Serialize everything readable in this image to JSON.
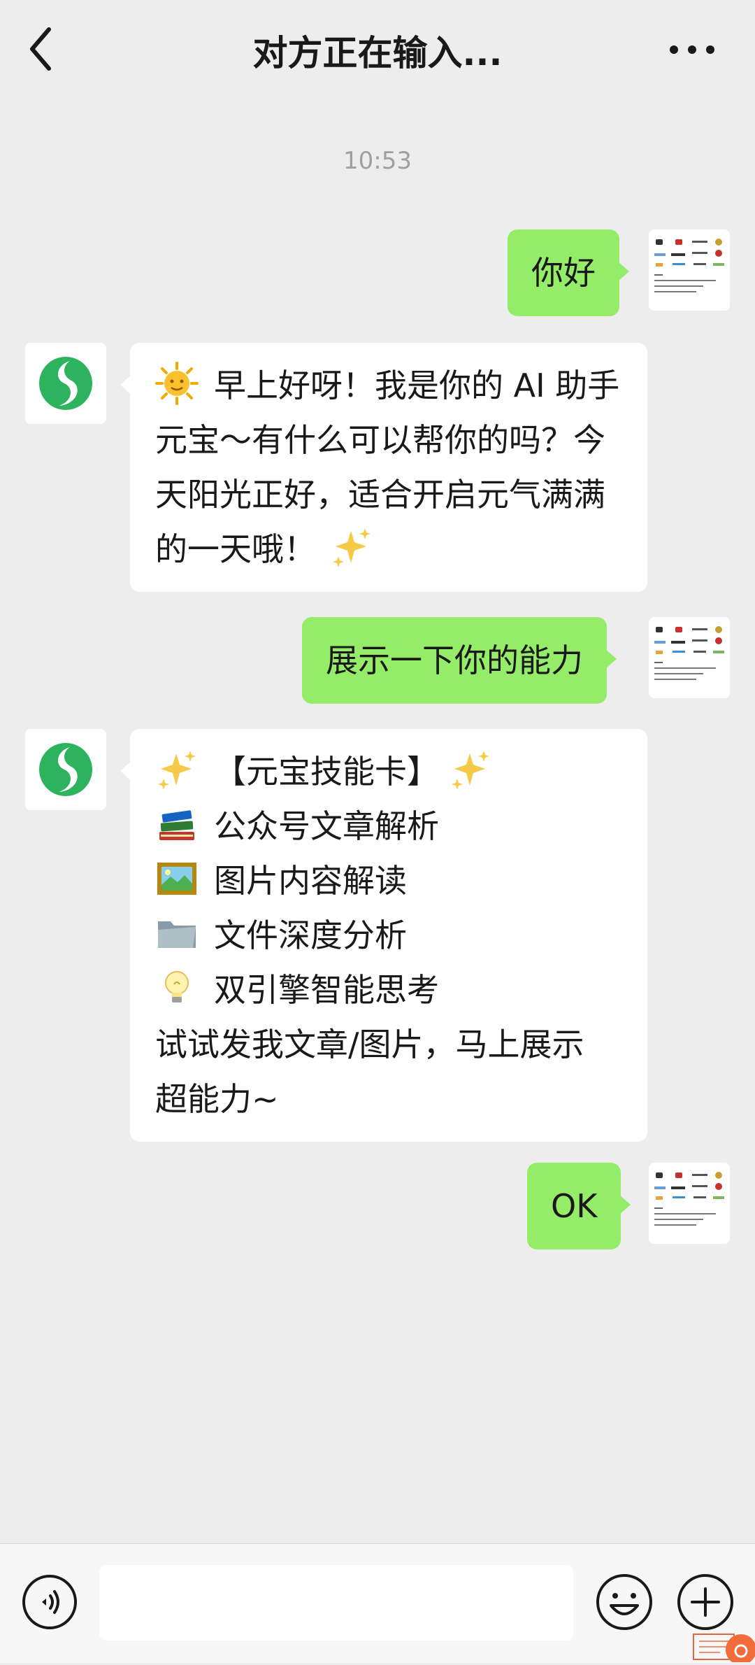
{
  "header": {
    "title": "对方正在输入..."
  },
  "timestamp": "10:53",
  "messages": [
    {
      "sender": "user",
      "text": "你好"
    },
    {
      "sender": "bot",
      "lines": [
        "早上好呀！我是你的 AI 助手",
        "元宝～有什么可以帮你的吗？今",
        "天阳光正好，适合开启元气满满",
        "的一天哦！"
      ]
    },
    {
      "sender": "user",
      "text": "展示一下你的能力"
    },
    {
      "sender": "bot",
      "lines": [
        "【元宝技能卡】",
        "公众号文章解析",
        "图片内容解读",
        "文件深度分析",
        "双引擎智能思考",
        "试试发我文章/图片，马上展示",
        "超能力~"
      ]
    },
    {
      "sender": "user",
      "text": "OK"
    }
  ],
  "icons": {
    "back": "chevron-left-icon",
    "more": "more-dots-icon",
    "voice": "voice-icon",
    "emoji": "smiley-face-icon",
    "plus": "plus-circle-icon",
    "sun": "sun-face-emoji",
    "sparkles": "sparkles-emoji",
    "books": "books-emoji",
    "picture": "framed-picture-emoji",
    "folder": "folder-emoji",
    "bulb": "light-bulb-emoji"
  },
  "colors": {
    "background": "#EDEDED",
    "user_bubble": "#95EC69",
    "bot_bubble": "#FFFFFF",
    "timestamp": "#9F9F9F",
    "bot_avatar": "#2DB35E"
  },
  "input": {
    "value": ""
  }
}
